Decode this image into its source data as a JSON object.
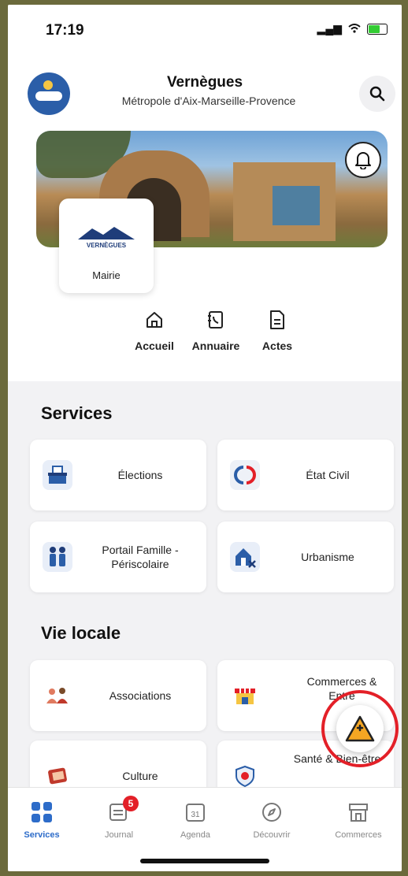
{
  "status": {
    "time": "17:19"
  },
  "header": {
    "city": "Vernègues",
    "region": "Métropole d'Aix-Marseille-Provence"
  },
  "mairie": {
    "logo_text": "VERNÈGUES",
    "label": "Mairie"
  },
  "quicknav": [
    {
      "label": "Accueil",
      "icon": "home-icon"
    },
    {
      "label": "Annuaire",
      "icon": "phonebook-icon"
    },
    {
      "label": "Actes",
      "icon": "document-icon"
    }
  ],
  "sections": {
    "services": {
      "title": "Services",
      "items": [
        {
          "label": "Élections",
          "icon": "ballot-box-icon"
        },
        {
          "label": "État Civil",
          "icon": "civil-status-icon"
        },
        {
          "label": "Portail Famille - Périscolaire",
          "icon": "family-icon"
        },
        {
          "label": "Urbanisme",
          "icon": "house-planning-icon"
        }
      ]
    },
    "vie_locale": {
      "title": "Vie locale",
      "items": [
        {
          "label": "Associations",
          "icon": "people-icon"
        },
        {
          "label": "Commerces & Entre",
          "icon": "shop-icon"
        },
        {
          "label": "Culture",
          "icon": "culture-icon"
        },
        {
          "label": "Santé & Bien-être",
          "icon": "health-icon"
        }
      ]
    }
  },
  "tabs": [
    {
      "label": "Services",
      "icon": "grid-icon",
      "active": true
    },
    {
      "label": "Journal",
      "icon": "newspaper-icon",
      "badge": "5"
    },
    {
      "label": "Agenda",
      "icon": "calendar-icon",
      "day": "31"
    },
    {
      "label": "Découvrir",
      "icon": "compass-icon"
    },
    {
      "label": "Commerces",
      "icon": "storefront-icon"
    }
  ],
  "colors": {
    "accent": "#2d6cc9",
    "alert": "#e32028",
    "warning": "#f5a623"
  }
}
